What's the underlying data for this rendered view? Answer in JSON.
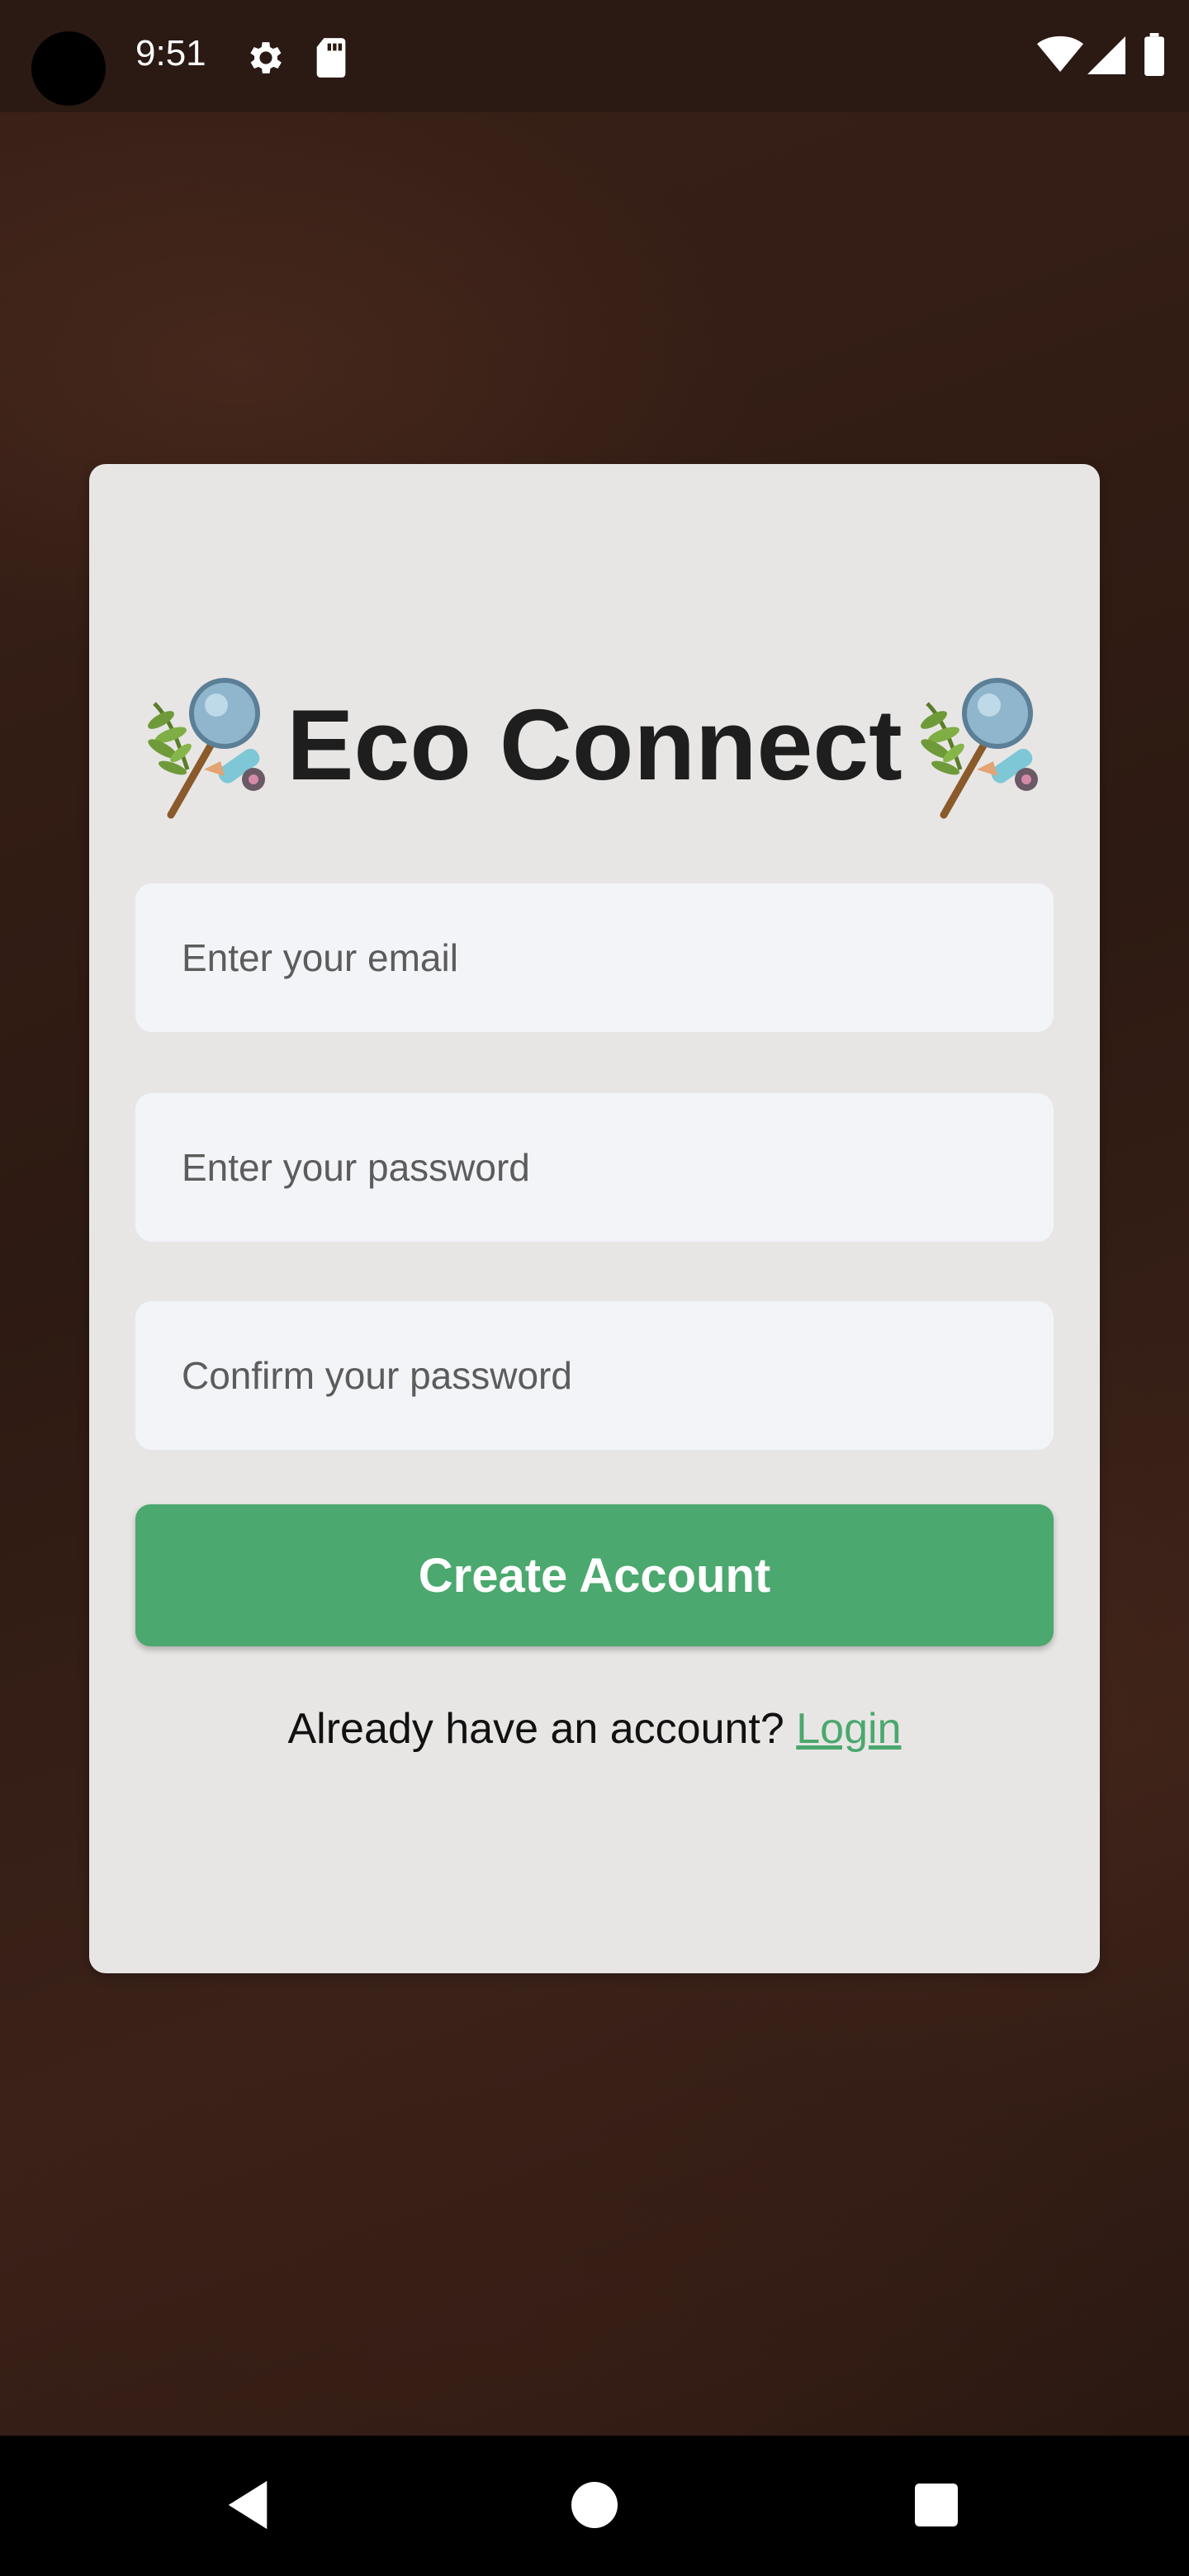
{
  "status_bar": {
    "time": "9:51",
    "icons": [
      "settings-icon",
      "sd-card-icon",
      "wifi-icon",
      "signal-icon",
      "battery-icon"
    ]
  },
  "app": {
    "title": "Eco Connect",
    "title_icon": "eco-tools-icon"
  },
  "form": {
    "email_placeholder": "Enter your email",
    "password_placeholder": "Enter your password",
    "confirm_password_placeholder": "Confirm your password",
    "submit_label": "Create Account",
    "login_prompt": "Already have an account?",
    "login_link": "Login"
  },
  "colors": {
    "accent": "#4ba86e",
    "card_bg": "#e8e6e5",
    "field_bg": "#f3f4f8",
    "background": "#2f1b14"
  },
  "nav_bar": {
    "icons": [
      "back-icon",
      "home-icon",
      "recents-icon"
    ]
  }
}
